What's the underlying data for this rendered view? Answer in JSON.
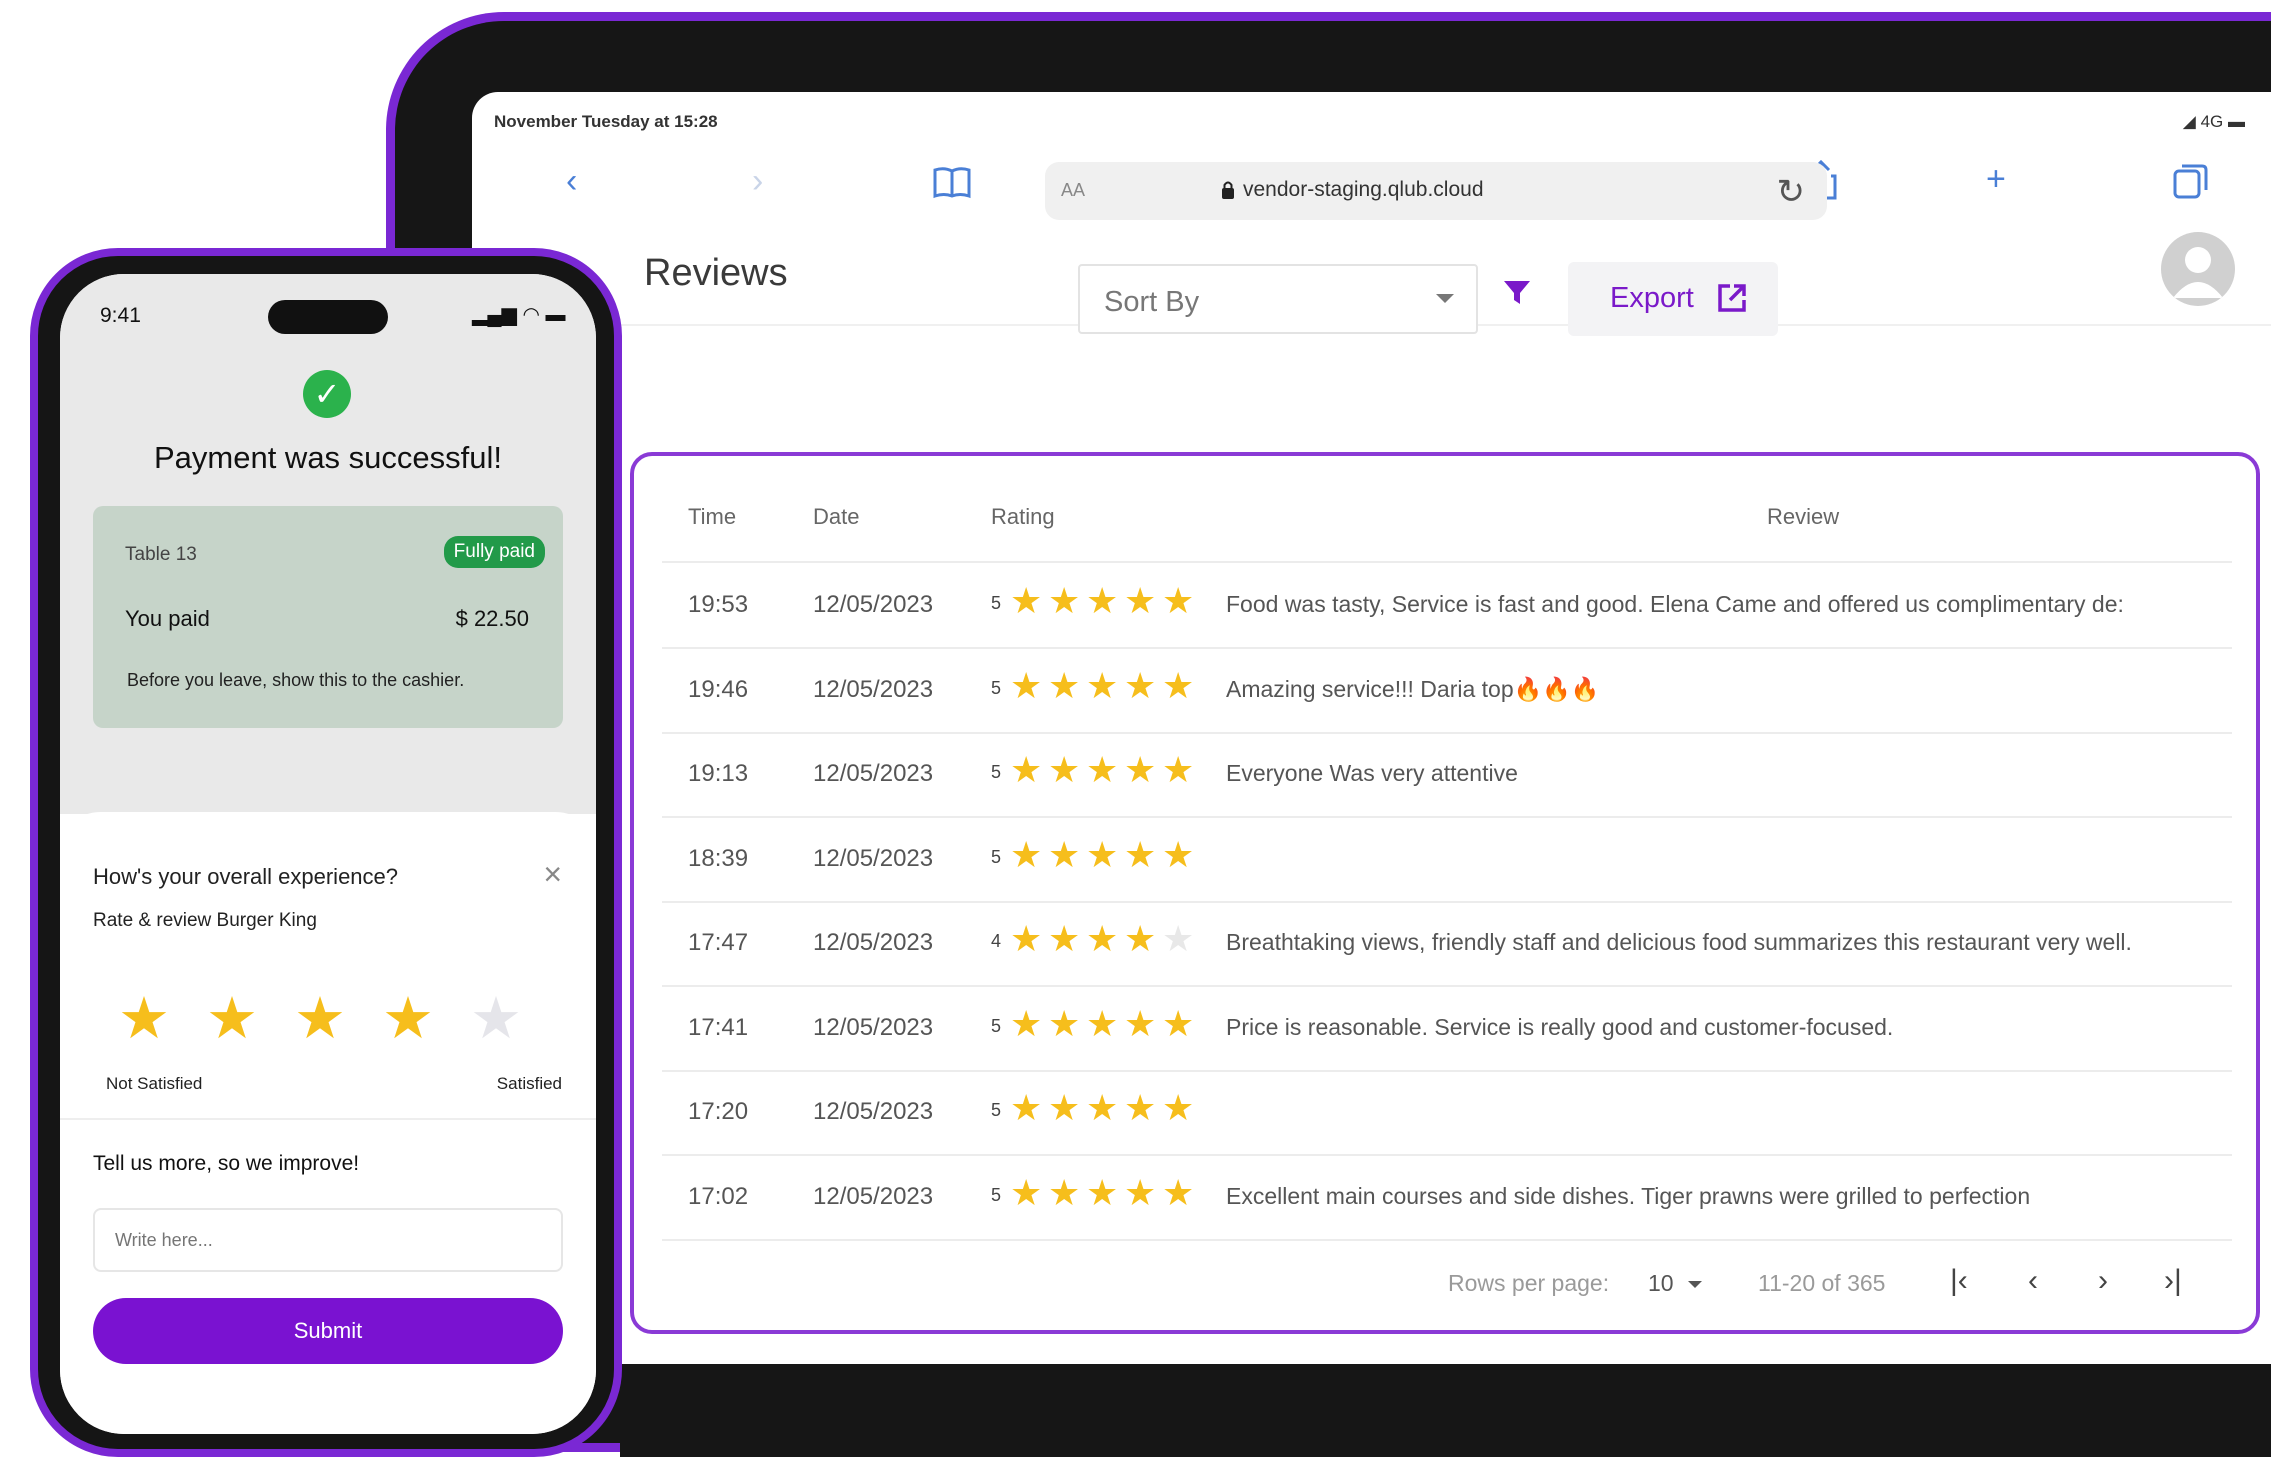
{
  "tablet": {
    "status": {
      "time": "November Tuesday at 15:28",
      "network": "◢ 4G ▬"
    },
    "browser": {
      "url_aa": "AA",
      "url": "vendor-staging.qlub.cloud"
    },
    "page_title": "Reviews",
    "sort_by": "Sort By",
    "export": "Export",
    "table": {
      "headers": {
        "time": "Time",
        "date": "Date",
        "rating": "Rating",
        "review": "Review"
      },
      "rows": [
        {
          "time": "19:53",
          "date": "12/05/2023",
          "rating": 5,
          "rating_text": "5",
          "review": "Food was tasty, Service is fast and good. Elena Came and offered us complimentary de:"
        },
        {
          "time": "19:46",
          "date": "12/05/2023",
          "rating": 5,
          "rating_text": "5",
          "review": "Amazing service!!! Daria top🔥🔥🔥"
        },
        {
          "time": "19:13",
          "date": "12/05/2023",
          "rating": 5,
          "rating_text": "5",
          "review": "Everyone Was very attentive"
        },
        {
          "time": "18:39",
          "date": "12/05/2023",
          "rating": 5,
          "rating_text": "5",
          "review": ""
        },
        {
          "time": "17:47",
          "date": "12/05/2023",
          "rating": 4,
          "rating_text": "4",
          "review": "Breathtaking views, friendly staff and delicious food summarizes this restaurant very well."
        },
        {
          "time": "17:41",
          "date": "12/05/2023",
          "rating": 5,
          "rating_text": "5",
          "review": "Price is reasonable. Service is really good and customer-focused."
        },
        {
          "time": "17:20",
          "date": "12/05/2023",
          "rating": 5,
          "rating_text": "5",
          "review": ""
        },
        {
          "time": "17:02",
          "date": "12/05/2023",
          "rating": 5,
          "rating_text": "5",
          "review": "Excellent main courses and side dishes. Tiger prawns were grilled to perfection"
        }
      ]
    },
    "footer": {
      "rows_per_page_label": "Rows per page:",
      "rows_per_page": "10",
      "range": "11-20 of 365"
    }
  },
  "phone": {
    "time": "9:41",
    "status_icons": "▂▄▆ ◠ ▬",
    "payment_title": "Payment was successful!",
    "table_label": "Table 13",
    "badge": "Fully paid",
    "you_paid_label": "You paid",
    "amount": "$ 22.50",
    "note": "Before you leave, show this to the cashier.",
    "question": "How's your overall experience?",
    "subtitle": "Rate & review Burger King",
    "rating": 4,
    "left_label": "Not Satisfied",
    "right_label": "Satisfied",
    "tell_more": "Tell us more, so we improve!",
    "input_placeholder": "Write here...",
    "submit": "Submit"
  },
  "colors": {
    "accent": "#7a12d1",
    "star": "#f6be1c",
    "success": "#2bb24c",
    "badge": "#229a49"
  }
}
